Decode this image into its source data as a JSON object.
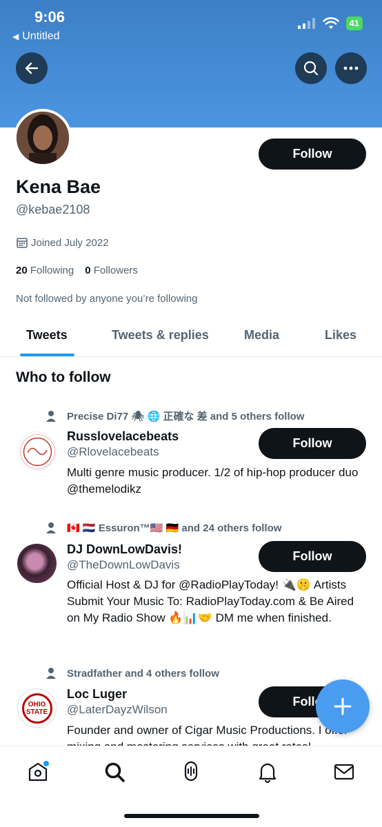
{
  "status_bar": {
    "time": "9:06",
    "back_app": "Untitled",
    "battery": "41"
  },
  "profile": {
    "name": "Kena Bae",
    "handle": "@kebae2108",
    "joined": "Joined July 2022",
    "following_count": "20",
    "following_label": "Following",
    "followers_count": "0",
    "followers_label": "Followers",
    "not_followed": "Not followed by anyone you’re following",
    "follow_label": "Follow"
  },
  "tabs": [
    "Tweets",
    "Tweets & replies",
    "Media",
    "Likes"
  ],
  "who_to_follow": {
    "title": "Who to follow",
    "suggestions": [
      {
        "social": "Precise Di77 🕷 🌐 正確な 差 and 5 others follow",
        "name": "Russlovelacebeats",
        "handle": "@Rlovelacebeats",
        "bio": "Multi genre music producer. 1/2 of hip-hop producer duo @themelodikz",
        "follow_label": "Follow"
      },
      {
        "social": "🇨🇦 🇳🇱 Essuron™🇺🇸 🇩🇪 and 24 others follow",
        "name": "DJ DownLowDavis!",
        "handle": "@TheDownLowDavis",
        "bio": "Official Host & DJ for @RadioPlayToday! 🔌🤫 Artists Submit Your Music To: RadioPlayToday.com & Be Aired on My Radio Show 🔥📊🤝 DM me when finished.",
        "follow_label": "Follow"
      },
      {
        "social": "Stradfather and 4 others follow",
        "name": "Loc Luger",
        "handle": "@LaterDayzWilson",
        "bio": "Founder and owner of Cigar Music Productions. I offer mixing and mastering services with great rates!",
        "follow_label": "Follow",
        "avatar_text": "OHIO STATE"
      }
    ]
  },
  "colors": {
    "banner": "#3d7fc6",
    "accent": "#1d9bf0",
    "button": "#0f1419"
  }
}
